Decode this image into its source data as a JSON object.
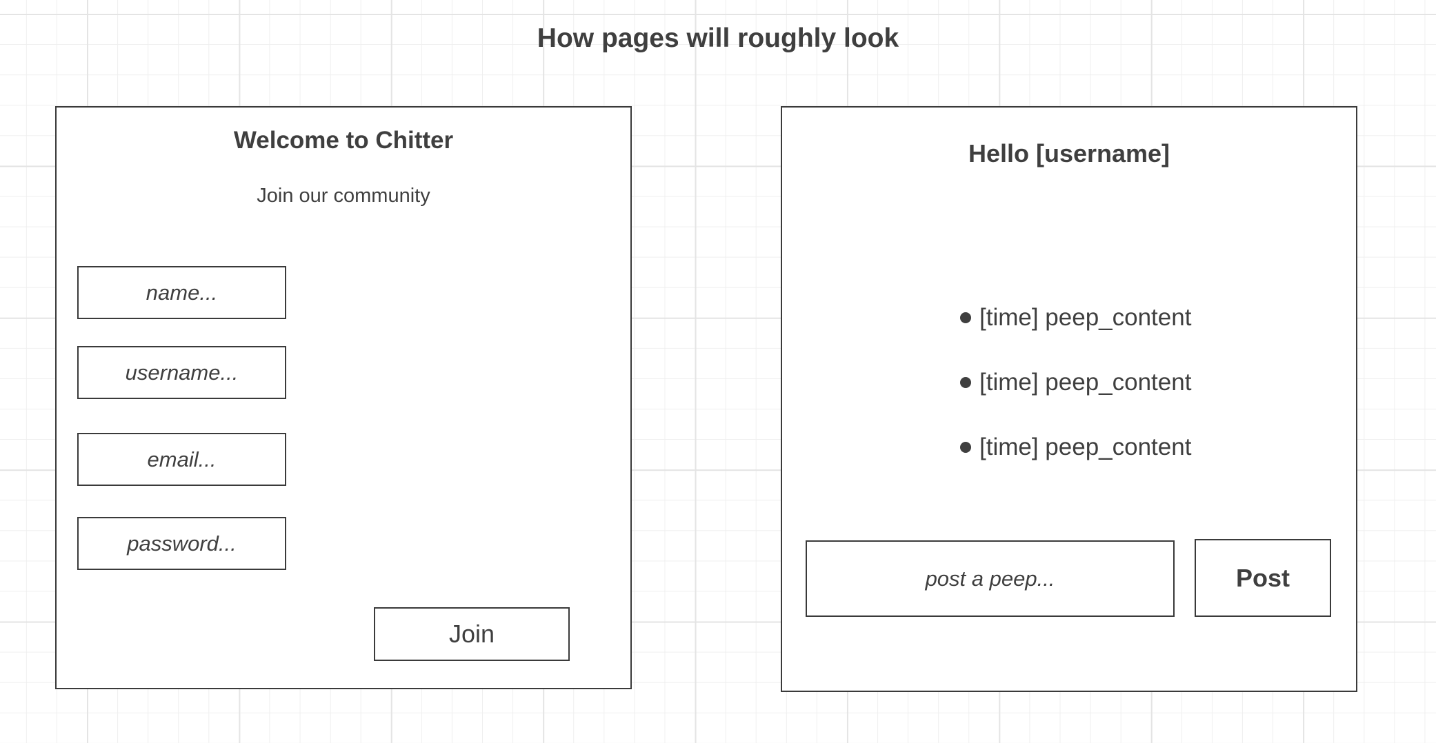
{
  "title": "How pages will roughly look",
  "signup_page": {
    "heading": "Welcome to Chitter",
    "subheading": "Join our community",
    "fields": [
      {
        "placeholder": "name..."
      },
      {
        "placeholder": "username..."
      },
      {
        "placeholder": "email..."
      },
      {
        "placeholder": "password..."
      }
    ],
    "join_label": "Join"
  },
  "feed_page": {
    "heading": "Hello [username]",
    "peeps": [
      "[time] peep_content",
      "[time] peep_content",
      "[time] peep_content"
    ],
    "input_placeholder": "post a peep...",
    "post_label": "Post"
  }
}
